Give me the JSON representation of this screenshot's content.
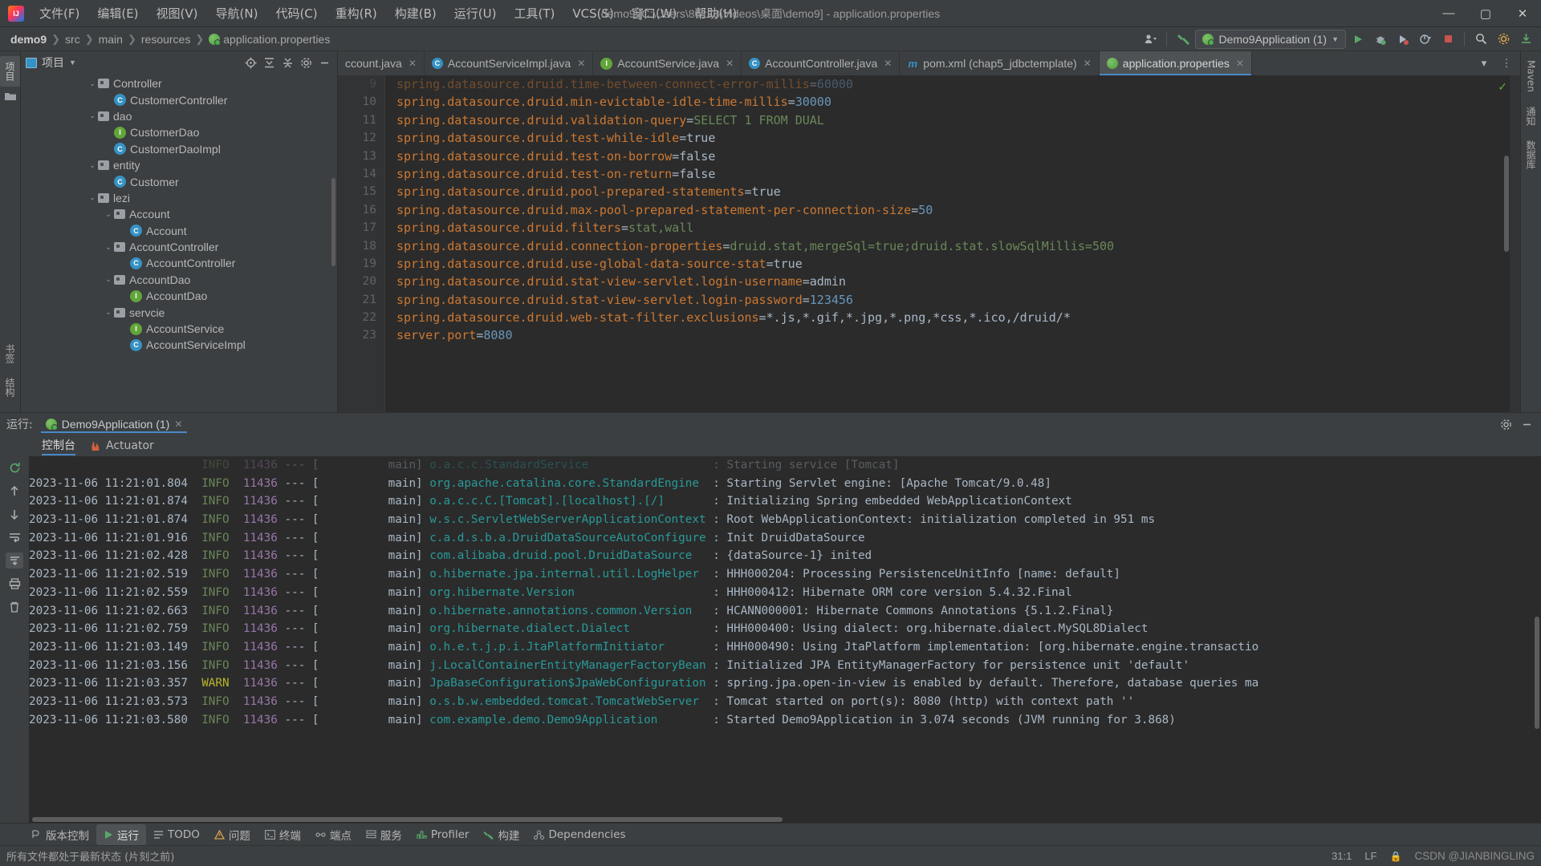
{
  "titlebar": {
    "logo_name": "intellij-idea-logo",
    "menus": [
      "文件(F)",
      "编辑(E)",
      "视图(V)",
      "导航(N)",
      "代码(C)",
      "重构(R)",
      "构建(B)",
      "运行(U)",
      "工具(T)",
      "VCS(S)",
      "窗口(W)",
      "帮助(H)"
    ],
    "window_title": "demo9 [C:\\Users\\86178\\Videos\\桌面\\demo9] - application.properties",
    "minimize": "—",
    "maximize": "▢",
    "close": "✕"
  },
  "navbar": {
    "breadcrumbs": [
      "demo9",
      "src",
      "main",
      "resources",
      "application.properties"
    ],
    "separator": "❯",
    "run_config": "Demo9Application (1)",
    "buttons": {
      "run": "▶",
      "debug": "🐞",
      "run_coverage": "▶",
      "profile": "⏱",
      "stop": "■",
      "search": "🔍",
      "settings": "⚙",
      "updates": "↻"
    }
  },
  "left_strip": {
    "project_tab": "项目",
    "bookmarks_tab": "书签",
    "structure_tab": "结构"
  },
  "right_strip": {
    "maven_tab": "Maven",
    "notifications_tab": "通知",
    "database_tab": "数据库"
  },
  "project_panel": {
    "title": "项目",
    "icons": [
      "locate-icon",
      "expand-all-icon",
      "collapse-all-icon",
      "settings-icon",
      "hide-icon"
    ],
    "tree": [
      {
        "indent": 2,
        "chevron": "⌄",
        "icon": "folder",
        "label": "Controller"
      },
      {
        "indent": 3,
        "chevron": "",
        "icon": "class",
        "label": "CustomerController"
      },
      {
        "indent": 2,
        "chevron": "⌄",
        "icon": "folder",
        "label": "dao"
      },
      {
        "indent": 3,
        "chevron": "",
        "icon": "interface",
        "label": "CustomerDao"
      },
      {
        "indent": 3,
        "chevron": "",
        "icon": "class",
        "label": "CustomerDaoImpl"
      },
      {
        "indent": 2,
        "chevron": "⌄",
        "icon": "folder",
        "label": "entity"
      },
      {
        "indent": 3,
        "chevron": "",
        "icon": "class",
        "label": "Customer"
      },
      {
        "indent": 2,
        "chevron": "⌄",
        "icon": "folder",
        "label": "lezi"
      },
      {
        "indent": 3,
        "chevron": "⌄",
        "icon": "folder",
        "label": "Account"
      },
      {
        "indent": 4,
        "chevron": "",
        "icon": "class",
        "label": "Account"
      },
      {
        "indent": 3,
        "chevron": "⌄",
        "icon": "folder",
        "label": "AccountController"
      },
      {
        "indent": 4,
        "chevron": "",
        "icon": "class",
        "label": "AccountController"
      },
      {
        "indent": 3,
        "chevron": "⌄",
        "icon": "folder",
        "label": "AccountDao"
      },
      {
        "indent": 4,
        "chevron": "",
        "icon": "interface",
        "label": "AccountDao"
      },
      {
        "indent": 3,
        "chevron": "⌄",
        "icon": "folder",
        "label": "servcie"
      },
      {
        "indent": 4,
        "chevron": "",
        "icon": "interface",
        "label": "AccountService"
      },
      {
        "indent": 4,
        "chevron": "",
        "icon": "class",
        "label": "AccountServiceImpl"
      }
    ]
  },
  "editor": {
    "tabs": [
      {
        "label": "ccount.java",
        "icon": "none",
        "active": false
      },
      {
        "label": "AccountServiceImpl.java",
        "icon": "class",
        "active": false
      },
      {
        "label": "AccountService.java",
        "icon": "interface",
        "active": false
      },
      {
        "label": "AccountController.java",
        "icon": "class",
        "active": false
      },
      {
        "label": "pom.xml (chap5_jdbctemplate)",
        "icon": "maven",
        "active": false
      },
      {
        "label": "application.properties",
        "icon": "spring",
        "active": true
      }
    ],
    "tab_close": "✕",
    "tabbar_right": [
      "chevron-down-icon",
      "more-icon"
    ],
    "inspection_status": "✓",
    "lines": [
      {
        "no": "9",
        "key": "spring.datasource.druid.time-between-connect-error-millis",
        "eq": "=",
        "val": "60000",
        "vtype": "n",
        "partial": true
      },
      {
        "no": "10",
        "key": "spring.datasource.druid.min-evictable-idle-time-millis",
        "eq": "=",
        "val": "30000",
        "vtype": "n"
      },
      {
        "no": "11",
        "key": "spring.datasource.druid.validation-query",
        "eq": "=",
        "val": "SELECT 1 FROM DUAL",
        "vtype": "s"
      },
      {
        "no": "12",
        "key": "spring.datasource.druid.test-while-idle",
        "eq": "=",
        "val": "true",
        "vtype": "eq"
      },
      {
        "no": "13",
        "key": "spring.datasource.druid.test-on-borrow",
        "eq": "=",
        "val": "false",
        "vtype": "eq"
      },
      {
        "no": "14",
        "key": "spring.datasource.druid.test-on-return",
        "eq": "=",
        "val": "false",
        "vtype": "eq"
      },
      {
        "no": "15",
        "key": "spring.datasource.druid.pool-prepared-statements",
        "eq": "=",
        "val": "true",
        "vtype": "eq"
      },
      {
        "no": "16",
        "key": "spring.datasource.druid.max-pool-prepared-statement-per-connection-size",
        "eq": "=",
        "val": "50",
        "vtype": "n"
      },
      {
        "no": "17",
        "key": "spring.datasource.druid.filters",
        "eq": "=",
        "val": "stat,wall",
        "vtype": "s"
      },
      {
        "no": "18",
        "key": "spring.datasource.druid.connection-properties",
        "eq": "=",
        "val": "druid.stat,mergeSql=true;druid.stat.slowSqlMillis=500",
        "vtype": "s"
      },
      {
        "no": "19",
        "key": "spring.datasource.druid.use-global-data-source-stat",
        "eq": "=",
        "val": "true",
        "vtype": "eq"
      },
      {
        "no": "20",
        "key": "spring.datasource.druid.stat-view-servlet.login-username",
        "eq": "=",
        "val": "admin",
        "vtype": "eq"
      },
      {
        "no": "21",
        "key": "spring.datasource.druid.stat-view-servlet.login-password",
        "eq": "=",
        "val": "123456",
        "vtype": "n"
      },
      {
        "no": "22",
        "key": "spring.datasource.druid.web-stat-filter.exclusions",
        "eq": "=",
        "val": "*.js,*.gif,*.jpg,*.png,*css,*.ico,/druid/*",
        "vtype": "eq"
      },
      {
        "no": "23",
        "key": "server.port",
        "eq": "=",
        "val": "8080",
        "vtype": "n"
      }
    ]
  },
  "run_panel": {
    "label": "运行:",
    "tab": "Demo9Application (1)",
    "tab_close": "✕",
    "settings_icon": "⚙",
    "hide_icon": "—",
    "subtabs": [
      {
        "label": "控制台",
        "icon": "console-icon",
        "active": true
      },
      {
        "label": "Actuator",
        "icon": "actuator-icon",
        "active": false
      }
    ],
    "side_icons": [
      "rerun-icon",
      "scroll-up-icon",
      "scroll-down-icon",
      "soft-wrap-icon",
      "scroll-to-end-icon",
      "print-icon",
      "clear-all-icon"
    ],
    "log": [
      {
        "time": "",
        "level": "INFO",
        "pid": "11436",
        "thread": "main",
        "logger": "o.a.c.c.StandardService",
        "msg": "Starting service [Tomcat]",
        "partial": true
      },
      {
        "time": "2023-11-06 11:21:01.804",
        "level": "INFO",
        "pid": "11436",
        "thread": "main",
        "logger": "org.apache.catalina.core.StandardEngine",
        "msg": "Starting Servlet engine: [Apache Tomcat/9.0.48]"
      },
      {
        "time": "2023-11-06 11:21:01.874",
        "level": "INFO",
        "pid": "11436",
        "thread": "main",
        "logger": "o.a.c.c.C.[Tomcat].[localhost].[/]",
        "msg": "Initializing Spring embedded WebApplicationContext"
      },
      {
        "time": "2023-11-06 11:21:01.874",
        "level": "INFO",
        "pid": "11436",
        "thread": "main",
        "logger": "w.s.c.ServletWebServerApplicationContext",
        "msg": "Root WebApplicationContext: initialization completed in 951 ms"
      },
      {
        "time": "2023-11-06 11:21:01.916",
        "level": "INFO",
        "pid": "11436",
        "thread": "main",
        "logger": "c.a.d.s.b.a.DruidDataSourceAutoConfigure",
        "msg": "Init DruidDataSource"
      },
      {
        "time": "2023-11-06 11:21:02.428",
        "level": "INFO",
        "pid": "11436",
        "thread": "main",
        "logger": "com.alibaba.druid.pool.DruidDataSource",
        "msg": "{dataSource-1} inited"
      },
      {
        "time": "2023-11-06 11:21:02.519",
        "level": "INFO",
        "pid": "11436",
        "thread": "main",
        "logger": "o.hibernate.jpa.internal.util.LogHelper",
        "msg": "HHH000204: Processing PersistenceUnitInfo [name: default]"
      },
      {
        "time": "2023-11-06 11:21:02.559",
        "level": "INFO",
        "pid": "11436",
        "thread": "main",
        "logger": "org.hibernate.Version",
        "msg": "HHH000412: Hibernate ORM core version 5.4.32.Final"
      },
      {
        "time": "2023-11-06 11:21:02.663",
        "level": "INFO",
        "pid": "11436",
        "thread": "main",
        "logger": "o.hibernate.annotations.common.Version",
        "msg": "HCANN000001: Hibernate Commons Annotations {5.1.2.Final}"
      },
      {
        "time": "2023-11-06 11:21:02.759",
        "level": "INFO",
        "pid": "11436",
        "thread": "main",
        "logger": "org.hibernate.dialect.Dialect",
        "msg": "HHH000400: Using dialect: org.hibernate.dialect.MySQL8Dialect"
      },
      {
        "time": "2023-11-06 11:21:03.149",
        "level": "INFO",
        "pid": "11436",
        "thread": "main",
        "logger": "o.h.e.t.j.p.i.JtaPlatformInitiator",
        "msg": "HHH000490: Using JtaPlatform implementation: [org.hibernate.engine.transactio"
      },
      {
        "time": "2023-11-06 11:21:03.156",
        "level": "INFO",
        "pid": "11436",
        "thread": "main",
        "logger": "j.LocalContainerEntityManagerFactoryBean",
        "msg": "Initialized JPA EntityManagerFactory for persistence unit 'default'"
      },
      {
        "time": "2023-11-06 11:21:03.357",
        "level": "WARN",
        "pid": "11436",
        "thread": "main",
        "logger": "JpaBaseConfiguration$JpaWebConfiguration",
        "msg": "spring.jpa.open-in-view is enabled by default. Therefore, database queries ma"
      },
      {
        "time": "2023-11-06 11:21:03.573",
        "level": "INFO",
        "pid": "11436",
        "thread": "main",
        "logger": "o.s.b.w.embedded.tomcat.TomcatWebServer",
        "msg": "Tomcat started on port(s): 8080 (http) with context path ''"
      },
      {
        "time": "2023-11-06 11:21:03.580",
        "level": "INFO",
        "pid": "11436",
        "thread": "main",
        "logger": "com.example.demo.Demo9Application",
        "msg": "Started Demo9Application in 3.074 seconds (JVM running for 3.868)"
      }
    ]
  },
  "toolwindow_bar": [
    {
      "label": "版本控制",
      "icon": "vcs-icon",
      "active": false
    },
    {
      "label": "运行",
      "icon": "run-icon",
      "active": true
    },
    {
      "label": "TODO",
      "icon": "todo-icon",
      "active": false
    },
    {
      "label": "问题",
      "icon": "problems-icon",
      "active": false
    },
    {
      "label": "终端",
      "icon": "terminal-icon",
      "active": false
    },
    {
      "label": "端点",
      "icon": "endpoints-icon",
      "active": false
    },
    {
      "label": "服务",
      "icon": "services-icon",
      "active": false
    },
    {
      "label": "Profiler",
      "icon": "profiler-icon",
      "active": false
    },
    {
      "label": "构建",
      "icon": "build-icon",
      "active": false
    },
    {
      "label": "Dependencies",
      "icon": "dependencies-icon",
      "active": false
    }
  ],
  "statusbar": {
    "message": "所有文件都处于最新状态 (片刻之前)",
    "caret": "31:1",
    "line_sep": "LF",
    "lock": "🔒",
    "watermark": "CSDN @JIANBINGLING"
  },
  "colors": {
    "accent_blue": "#4a88c7",
    "key_orange": "#cc7832",
    "number_blue": "#6897bb",
    "string_green": "#6a8759",
    "logger_teal": "#299999",
    "warn_yellow": "#bbb529",
    "info_green": "#6a8759",
    "pid_purple": "#9876aa",
    "panel_bg": "#3c3f41",
    "editor_bg": "#2b2b2b"
  }
}
